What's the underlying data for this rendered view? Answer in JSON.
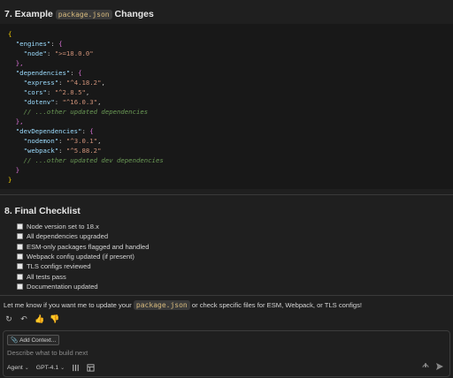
{
  "section7": {
    "prefix": "7. Example",
    "code": "package.json",
    "suffix": "Changes"
  },
  "code_lines": [
    {
      "parts": [
        [
          "brace",
          "{"
        ]
      ]
    },
    {
      "parts": [
        [
          "key",
          "  \"engines\""
        ],
        [
          "punc",
          ": "
        ],
        [
          "brace2",
          "{"
        ]
      ]
    },
    {
      "parts": [
        [
          "key",
          "    \"node\""
        ],
        [
          "punc",
          ": "
        ],
        [
          "str",
          "\">=18.0.0\""
        ]
      ]
    },
    {
      "parts": [
        [
          "brace2",
          "  },"
        ]
      ]
    },
    {
      "parts": [
        [
          "key",
          "  \"dependencies\""
        ],
        [
          "punc",
          ": "
        ],
        [
          "brace2",
          "{"
        ]
      ]
    },
    {
      "parts": [
        [
          "key",
          "    \"express\""
        ],
        [
          "punc",
          ": "
        ],
        [
          "str",
          "\"^4.18.2\""
        ],
        [
          "punc",
          ","
        ]
      ]
    },
    {
      "parts": [
        [
          "key",
          "    \"cors\""
        ],
        [
          "punc",
          ": "
        ],
        [
          "str",
          "\"^2.8.5\""
        ],
        [
          "punc",
          ","
        ]
      ]
    },
    {
      "parts": [
        [
          "key",
          "    \"dotenv\""
        ],
        [
          "punc",
          ": "
        ],
        [
          "str",
          "\"^16.0.3\""
        ],
        [
          "punc",
          ","
        ]
      ]
    },
    {
      "parts": [
        [
          "cmt",
          "    // ...other updated dependencies"
        ]
      ]
    },
    {
      "parts": [
        [
          "brace2",
          "  },"
        ]
      ]
    },
    {
      "parts": [
        [
          "key",
          "  \"devDependencies\""
        ],
        [
          "punc",
          ": "
        ],
        [
          "brace2",
          "{"
        ]
      ]
    },
    {
      "parts": [
        [
          "key",
          "    \"nodemon\""
        ],
        [
          "punc",
          ": "
        ],
        [
          "str",
          "\"^3.0.1\""
        ],
        [
          "punc",
          ","
        ]
      ]
    },
    {
      "parts": [
        [
          "key",
          "    \"webpack\""
        ],
        [
          "punc",
          ": "
        ],
        [
          "str",
          "\"^5.88.2\""
        ]
      ]
    },
    {
      "parts": [
        [
          "cmt",
          "    // ...other updated dev dependencies"
        ]
      ]
    },
    {
      "parts": [
        [
          "brace2",
          "  }"
        ]
      ]
    },
    {
      "parts": [
        [
          "brace",
          "}"
        ]
      ]
    }
  ],
  "section8": {
    "title": "8. Final Checklist",
    "items": [
      "Node version set to 18.x",
      "All dependencies upgraded",
      "ESM-only packages flagged and handled",
      "Webpack config updated (if present)",
      "TLS configs reviewed",
      "All tests pass",
      "Documentation updated"
    ]
  },
  "message": {
    "before": "Let me know if you want me to update your",
    "code": "package.json",
    "after": "or check specific files for ESM, Webpack, or TLS configs!"
  },
  "chat": {
    "add_context": "Add Context...",
    "placeholder": "Describe what to build next",
    "mode": "Agent",
    "model": "GPT-4.1"
  }
}
